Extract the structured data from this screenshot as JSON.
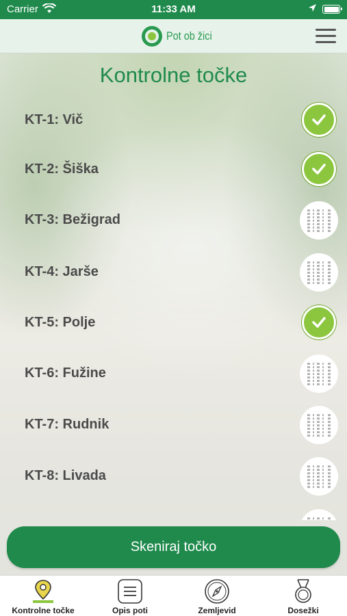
{
  "status_bar": {
    "carrier": "Carrier",
    "time": "11:33 AM"
  },
  "header": {
    "logo_text": "Pot ob žici"
  },
  "page_title": "Kontrolne točke",
  "checkpoints": [
    {
      "label": "KT-1: Vič",
      "status": "done"
    },
    {
      "label": "KT-2: Šiška",
      "status": "done"
    },
    {
      "label": "KT-3: Bežigrad",
      "status": "pending"
    },
    {
      "label": "KT-4: Jarše",
      "status": "pending"
    },
    {
      "label": "KT-5: Polje",
      "status": "done"
    },
    {
      "label": "KT-6: Fužine",
      "status": "pending"
    },
    {
      "label": "KT-7: Rudnik",
      "status": "pending"
    },
    {
      "label": "KT-8: Livada",
      "status": "pending"
    }
  ],
  "scan_button": "Skeniraj točko",
  "tabs": [
    {
      "label": "Kontrolne točke",
      "icon": "map-pin-icon",
      "active": true
    },
    {
      "label": "Opis poti",
      "icon": "list-icon",
      "active": false
    },
    {
      "label": "Zemljevid",
      "icon": "compass-icon",
      "active": false
    },
    {
      "label": "Dosežki",
      "icon": "medal-icon",
      "active": false
    }
  ],
  "colors": {
    "primary": "#1f8a4c",
    "done": "#8cc63f",
    "header_bg": "#e6f2ea"
  }
}
